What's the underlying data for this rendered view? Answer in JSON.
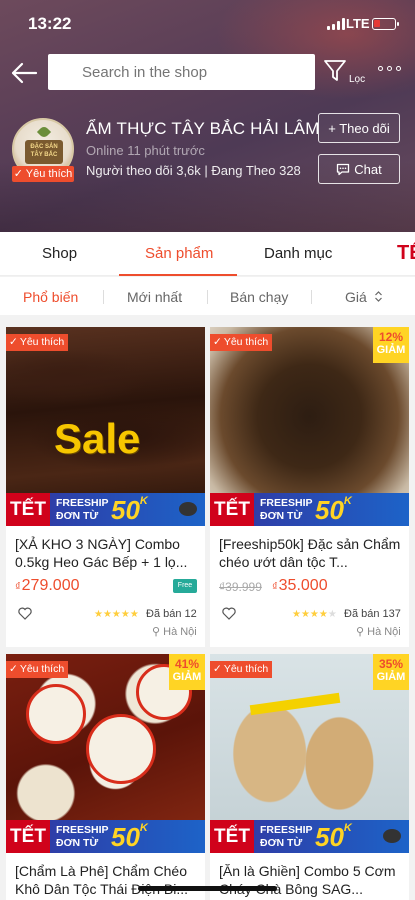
{
  "status_bar": {
    "time": "13:22",
    "network": "LTE"
  },
  "header": {
    "search_placeholder": "Search in the shop",
    "filter_label": "Lọc"
  },
  "shop": {
    "name": "ẨM THỰC TÂY BẮC HẢI LÂM",
    "online": "Online 11 phút trước",
    "followers_line": "Người theo dõi 3,6k | Đang Theo 328",
    "badge": "Yêu thích",
    "avatar_text": "ĐẶC SẢN TÂY BẮC",
    "follow_label": "+ Theo dõi",
    "chat_label": "Chat"
  },
  "tabs": [
    {
      "label": "Shop"
    },
    {
      "label": "Sản phẩm",
      "active": true
    },
    {
      "label": "Danh mục"
    },
    {
      "label": "TẾ"
    }
  ],
  "sort": [
    {
      "label": "Phổ biến",
      "active": true
    },
    {
      "label": "Mới nhất"
    },
    {
      "label": "Bán chạy"
    },
    {
      "label": "Giá"
    }
  ],
  "banner": {
    "tet": "TẾT",
    "line1": "FREESHIP",
    "line2": "ĐƠN TỪ",
    "amount": "50",
    "unit": "K"
  },
  "products": [
    {
      "title": "[XẢ KHO 3 NGÀY] Combo 0.5kg Heo Gác Bếp + 1 lọ...",
      "ribbon": "Yêu thích",
      "image_text": "Sale",
      "price_currency": "₫",
      "price": "279.000",
      "free_tag": "Free",
      "rating": 5,
      "sold": "Đã bán 12",
      "location": "Hà Nội"
    },
    {
      "title": "[Freeship50k] Đặc sản Chẩm chéo ướt dân tộc T...",
      "ribbon": "Yêu thích",
      "discount": "12%",
      "discount_word": "GIẢM",
      "old_price": "₫39.999",
      "price_currency": "₫",
      "price": "35.000",
      "rating": 4.5,
      "sold": "Đã bán 137",
      "location": "Hà Nội"
    },
    {
      "title": "[Chẩm Là Phê] Chẩm Chéo Khô Dân Tộc Thái Điện Bi...",
      "ribbon": "Yêu thích",
      "discount": "41%",
      "discount_word": "GIẢM"
    },
    {
      "title": "[Ăn là Ghiền] Combo 5 Cơm Cháy Chà Bông SAG...",
      "ribbon": "Yêu thích",
      "discount": "35%",
      "discount_word": "GIẢM"
    }
  ],
  "colors": {
    "accent": "#ee4d2d",
    "tet_red": "#d0021b",
    "discount_yellow": "#ffd424",
    "freeship_blue": "#2e3ea8"
  }
}
